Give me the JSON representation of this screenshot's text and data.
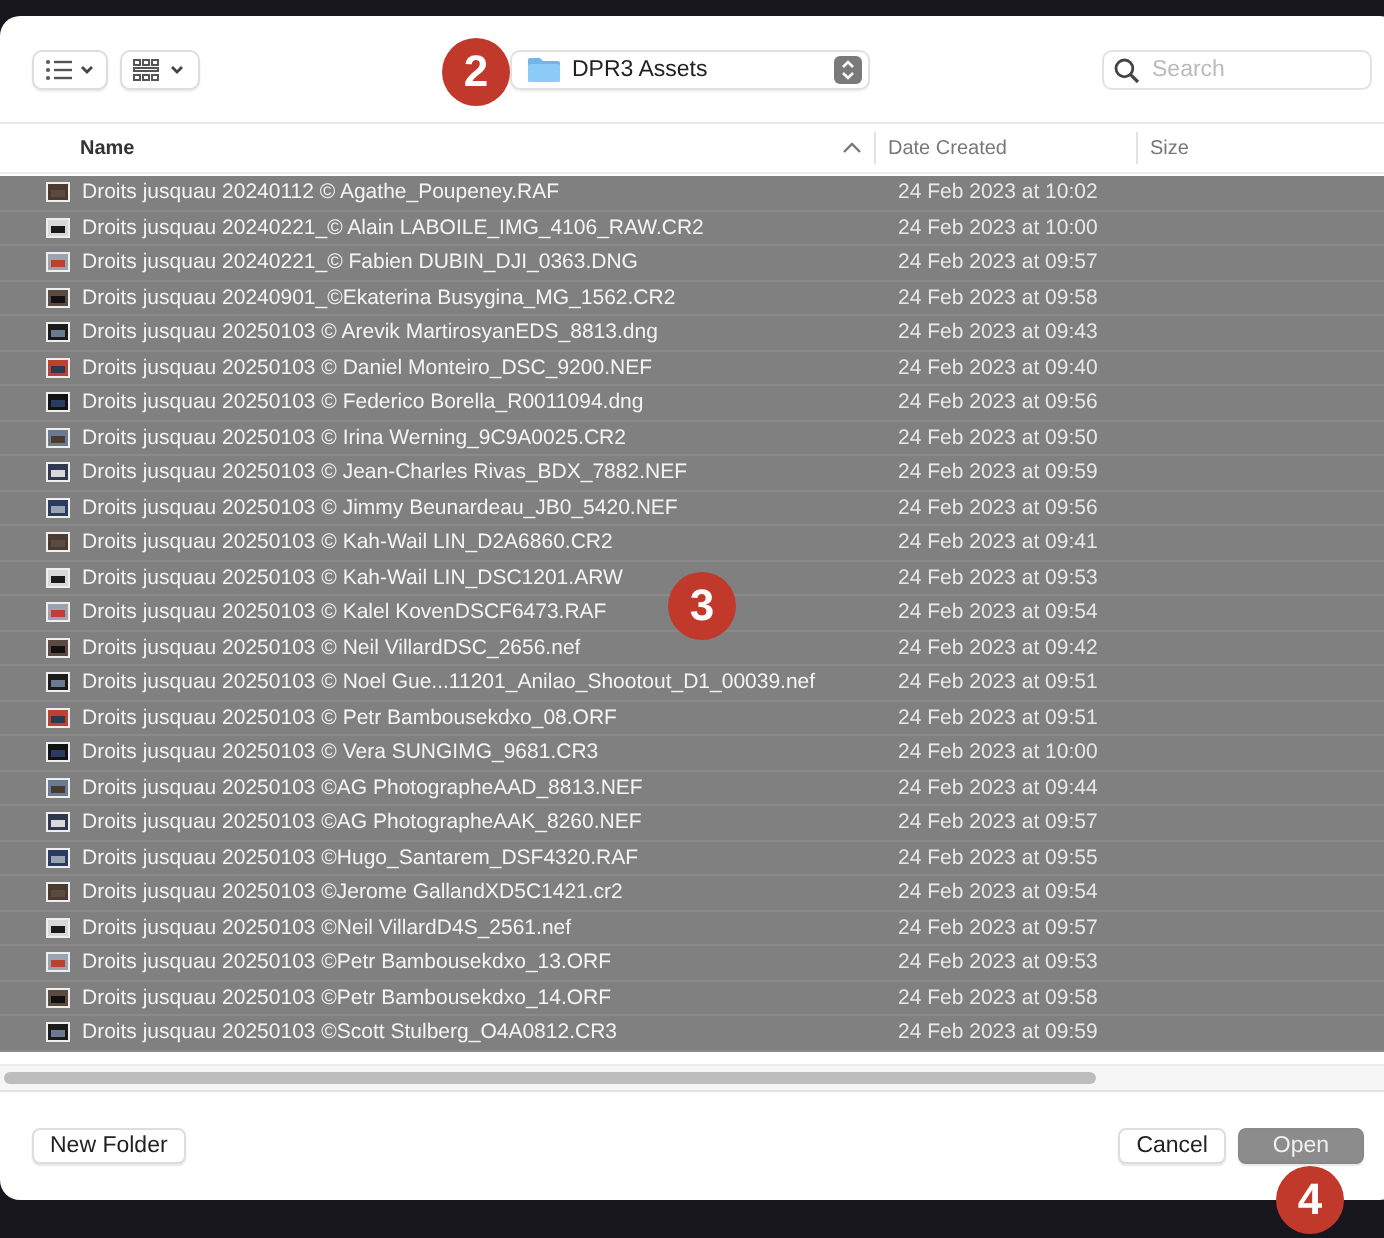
{
  "toolbar": {
    "location": "DPR3 Assets",
    "search": {
      "placeholder": "Search"
    }
  },
  "columns": [
    {
      "label": "Name",
      "sorted": true
    },
    {
      "label": "Date Created",
      "sorted": false
    },
    {
      "label": "Size",
      "sorted": false
    }
  ],
  "rows": [
    {
      "name": "Droits jusquau 20240112 © Agathe_Poupeney.RAF",
      "date": "24 Feb 2023 at 10:02",
      "selected": true
    },
    {
      "name": "Droits jusquau 20240221_© Alain LABOILE_IMG_4106_RAW.CR2",
      "date": "24 Feb 2023 at 10:00",
      "selected": true
    },
    {
      "name": "Droits jusquau 20240221_© Fabien DUBIN_DJI_0363.DNG",
      "date": "24 Feb 2023 at 09:57",
      "selected": true
    },
    {
      "name": "Droits jusquau 20240901_©Ekaterina Busygina_MG_1562.CR2",
      "date": "24 Feb 2023 at 09:58",
      "selected": true
    },
    {
      "name": "Droits jusquau 20250103 © Arevik MartirosyanEDS_8813.dng",
      "date": "24 Feb 2023 at 09:43",
      "selected": true
    },
    {
      "name": "Droits jusquau 20250103 © Daniel Monteiro_DSC_9200.NEF",
      "date": "24 Feb 2023 at 09:40",
      "selected": true
    },
    {
      "name": "Droits jusquau 20250103 © Federico Borella_R0011094.dng",
      "date": "24 Feb 2023 at 09:56",
      "selected": true
    },
    {
      "name": "Droits jusquau 20250103 © Irina Werning_9C9A0025.CR2",
      "date": "24 Feb 2023 at 09:50",
      "selected": true
    },
    {
      "name": "Droits jusquau 20250103 © Jean-Charles Rivas_BDX_7882.NEF",
      "date": "24 Feb 2023 at 09:59",
      "selected": true
    },
    {
      "name": "Droits jusquau 20250103 © Jimmy Beunardeau_JB0_5420.NEF",
      "date": "24 Feb 2023 at 09:56",
      "selected": true
    },
    {
      "name": "Droits jusquau 20250103 © Kah-Wail LIN_D2A6860.CR2",
      "date": "24 Feb 2023 at 09:41",
      "selected": true
    },
    {
      "name": "Droits jusquau 20250103 © Kah-Wail LIN_DSC1201.ARW",
      "date": "24 Feb 2023 at 09:53",
      "selected": true
    },
    {
      "name": "Droits jusquau 20250103 © Kalel KovenDSCF6473.RAF",
      "date": "24 Feb 2023 at 09:54",
      "selected": true
    },
    {
      "name": "Droits jusquau 20250103 © Neil VillardDSC_2656.nef",
      "date": "24 Feb 2023 at 09:42",
      "selected": true
    },
    {
      "name": "Droits jusquau 20250103 © Noel Gue...11201_Anilao_Shootout_D1_00039.nef",
      "date": "24 Feb 2023 at 09:51",
      "selected": true
    },
    {
      "name": "Droits jusquau 20250103 © Petr Bambousekdxo_08.ORF",
      "date": "24 Feb 2023 at 09:51",
      "selected": true
    },
    {
      "name": "Droits jusquau 20250103 © Vera SUNGIMG_9681.CR3",
      "date": "24 Feb 2023 at 10:00",
      "selected": true
    },
    {
      "name": "Droits jusquau 20250103 ©AG PhotographeAAD_8813.NEF",
      "date": "24 Feb 2023 at 09:44",
      "selected": true
    },
    {
      "name": "Droits jusquau 20250103 ©AG PhotographeAAK_8260.NEF",
      "date": "24 Feb 2023 at 09:57",
      "selected": true
    },
    {
      "name": "Droits jusquau 20250103 ©Hugo_Santarem_DSF4320.RAF",
      "date": "24 Feb 2023 at 09:55",
      "selected": true
    },
    {
      "name": "Droits jusquau 20250103 ©Jerome GallandXD5C1421.cr2",
      "date": "24 Feb 2023 at 09:54",
      "selected": true
    },
    {
      "name": "Droits jusquau 20250103 ©Neil VillardD4S_2561.nef",
      "date": "24 Feb 2023 at 09:57",
      "selected": true
    },
    {
      "name": "Droits jusquau 20250103 ©Petr Bambousekdxo_13.ORF",
      "date": "24 Feb 2023 at 09:53",
      "selected": true
    },
    {
      "name": "Droits jusquau 20250103 ©Petr Bambousekdxo_14.ORF",
      "date": "24 Feb 2023 at 09:58",
      "selected": true
    },
    {
      "name": "Droits jusquau 20250103 ©Scott Stulberg_O4A0812.CR3",
      "date": "24 Feb 2023 at 09:59",
      "selected": true
    }
  ],
  "buttons": [
    {
      "label": "New Folder",
      "kind": "plain"
    },
    {
      "label": "Cancel",
      "kind": "plain"
    },
    {
      "label": "Open",
      "kind": "default"
    }
  ],
  "badges": [
    {
      "label": "2"
    },
    {
      "label": "3"
    },
    {
      "label": "4"
    }
  ]
}
